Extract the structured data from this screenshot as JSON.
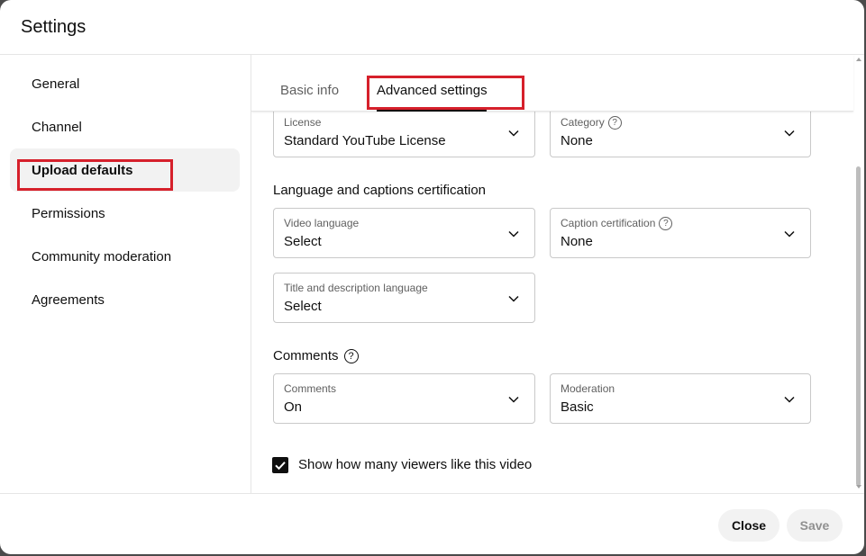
{
  "dialog": {
    "title": "Settings"
  },
  "sidebar": {
    "items": [
      {
        "label": "General"
      },
      {
        "label": "Channel"
      },
      {
        "label": "Upload defaults"
      },
      {
        "label": "Permissions"
      },
      {
        "label": "Community moderation"
      },
      {
        "label": "Agreements"
      }
    ],
    "active_index": 2
  },
  "tabs": [
    {
      "label": "Basic info"
    },
    {
      "label": "Advanced settings"
    }
  ],
  "license": {
    "label": "License",
    "value": "Standard YouTube License"
  },
  "category": {
    "label": "Category",
    "value": "None"
  },
  "language_section": {
    "title": "Language and captions certification"
  },
  "video_language": {
    "label": "Video language",
    "value": "Select"
  },
  "caption_certification": {
    "label": "Caption certification",
    "value": "None"
  },
  "title_desc_language": {
    "label": "Title and description language",
    "value": "Select"
  },
  "comments_section": {
    "title": "Comments"
  },
  "comments": {
    "label": "Comments",
    "value": "On"
  },
  "moderation": {
    "label": "Moderation",
    "value": "Basic"
  },
  "likes_checkbox": {
    "label": "Show how many viewers like this video",
    "checked": true
  },
  "footer": {
    "close_label": "Close",
    "save_label": "Save"
  },
  "colors": {
    "highlight": "#d6202b",
    "active_bg": "#f2f2f2"
  }
}
